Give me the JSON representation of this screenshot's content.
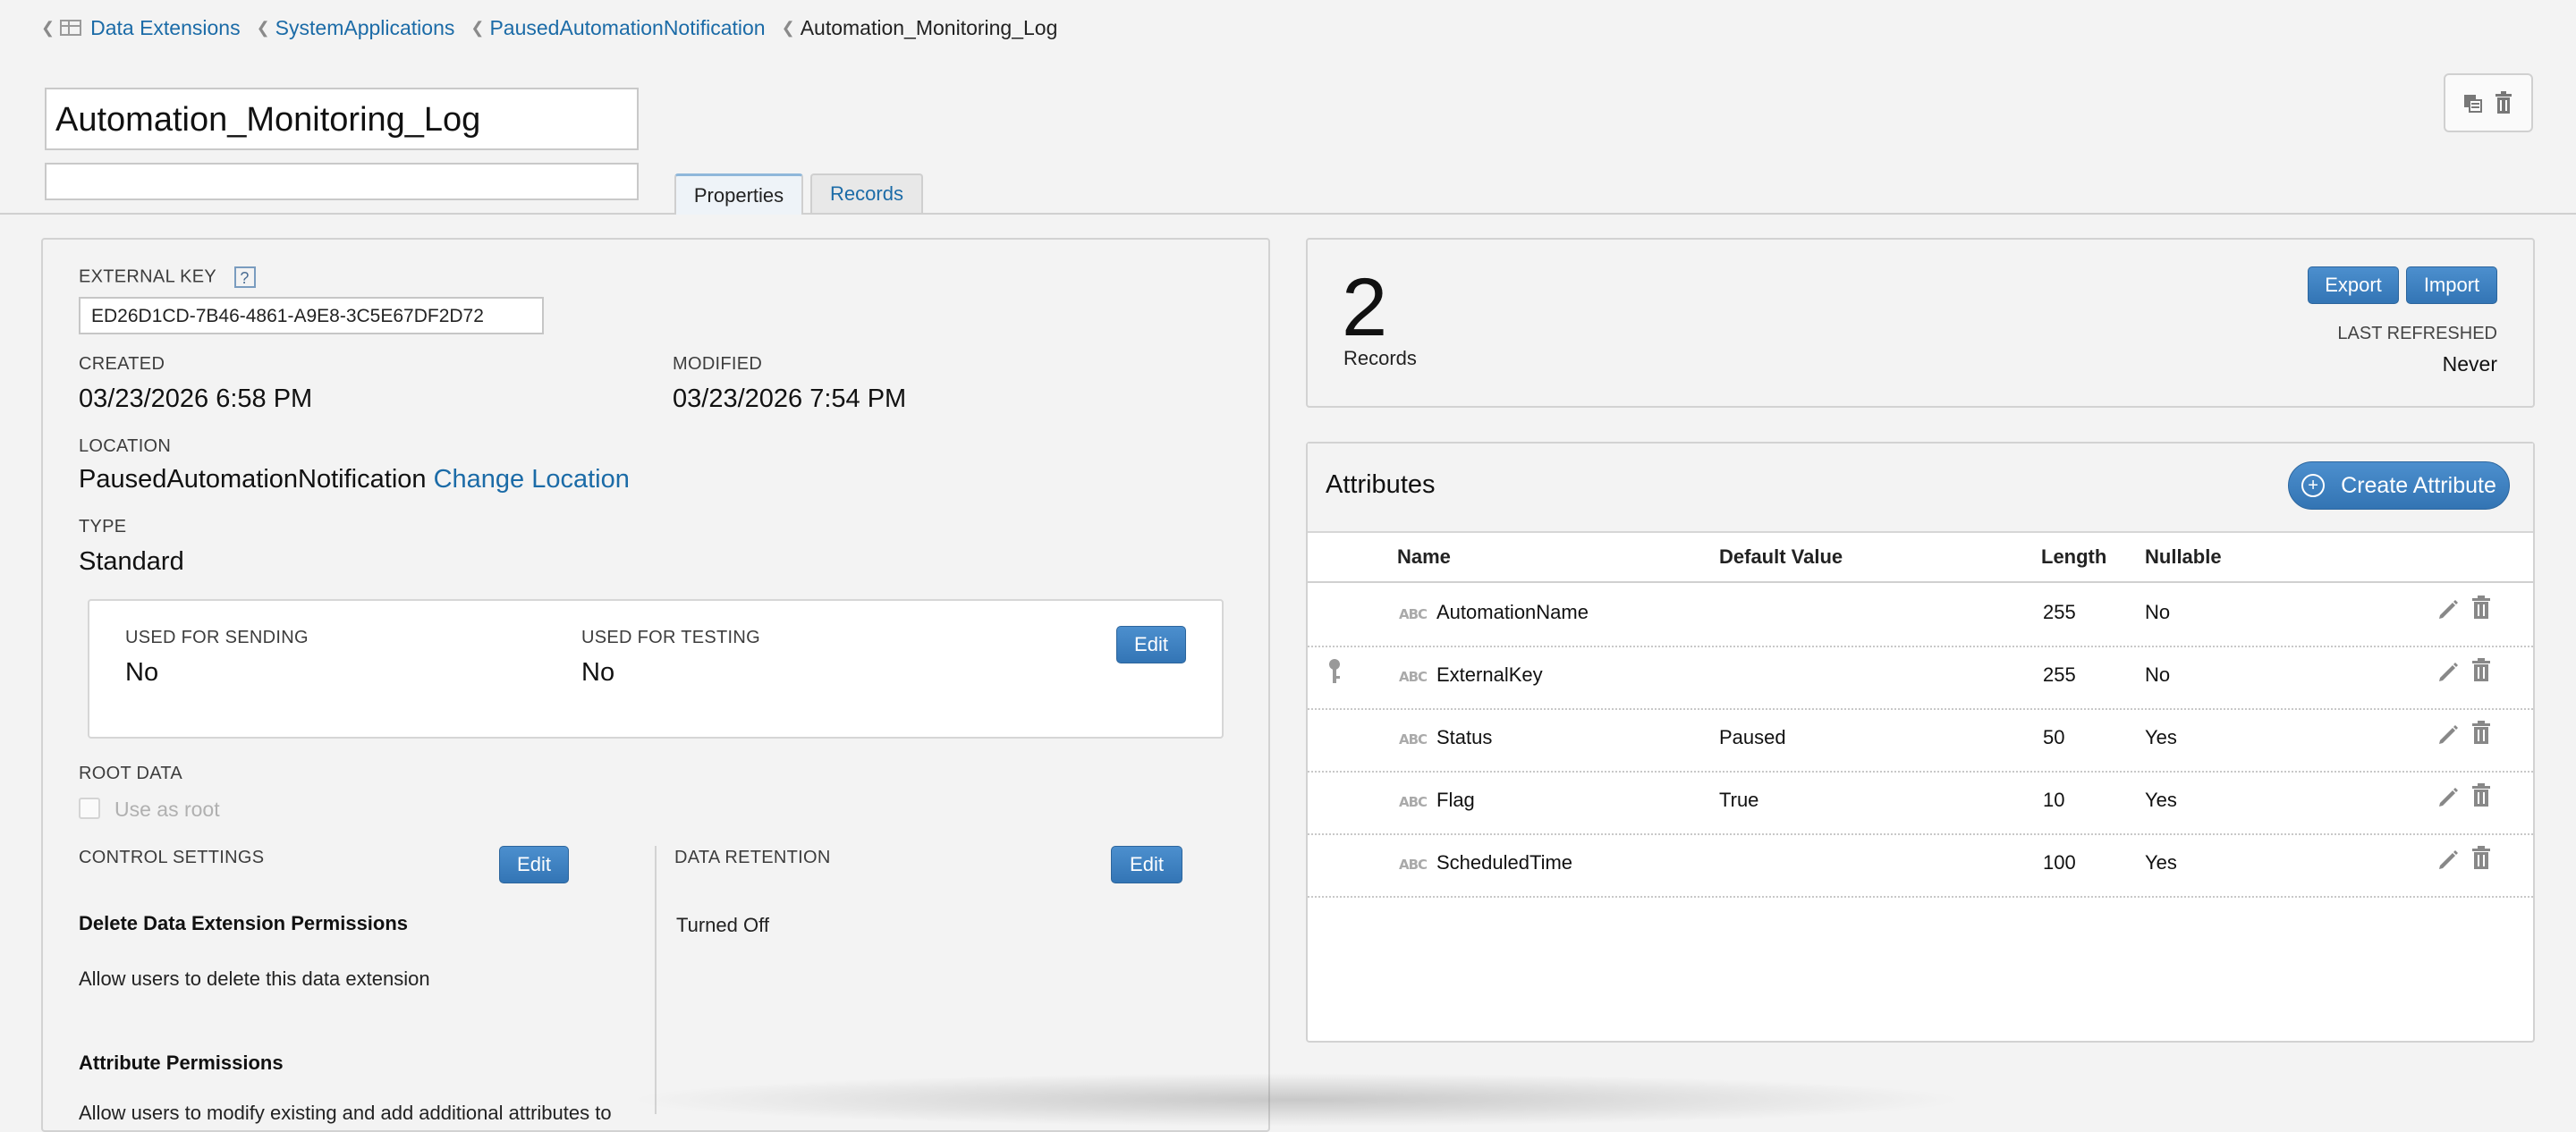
{
  "breadcrumb": {
    "items": [
      "Data Extensions",
      "SystemApplications",
      "PausedAutomationNotification"
    ],
    "current": "Automation_Monitoring_Log"
  },
  "header": {
    "name_value": "Automation_Monitoring_Log",
    "description_value": ""
  },
  "tabs": [
    {
      "label": "Properties",
      "active": true
    },
    {
      "label": "Records",
      "active": false
    }
  ],
  "properties": {
    "external_key_label": "EXTERNAL KEY",
    "external_key_value": "ED26D1CD-7B46-4861-A9E8-3C5E67DF2D72",
    "help_glyph": "?",
    "created_label": "CREATED",
    "created_value": "03/23/2026 6:58 PM",
    "modified_label": "MODIFIED",
    "modified_value": "03/23/2026 7:54 PM",
    "location_label": "LOCATION",
    "location_value": "PausedAutomationNotification",
    "change_location": "Change Location",
    "type_label": "TYPE",
    "type_value": "Standard",
    "used_for_sending_label": "USED FOR SENDING",
    "used_for_sending_value": "No",
    "used_for_testing_label": "USED FOR TESTING",
    "used_for_testing_value": "No",
    "edit_label": "Edit",
    "root_data_label": "ROOT DATA",
    "use_as_root": "Use as root",
    "control_settings_label": "CONTROL SETTINGS",
    "data_retention_label": "DATA RETENTION",
    "delete_permissions_heading": "Delete Data Extension Permissions",
    "delete_permissions_text": "Allow users to delete this data extension",
    "attribute_permissions_heading": "Attribute Permissions",
    "attribute_permissions_text": "Allow users to modify existing and add additional attributes to",
    "retention_value": "Turned Off"
  },
  "records": {
    "count": "2",
    "label": "Records",
    "export": "Export",
    "import": "Import",
    "last_refreshed_label": "LAST REFRESHED",
    "last_refreshed_value": "Never"
  },
  "attributes": {
    "title": "Attributes",
    "create_button": "Create Attribute",
    "columns": [
      "Name",
      "Default Value",
      "Length",
      "Nullable"
    ],
    "type_badge": "ABC",
    "rows": [
      {
        "name": "AutomationName",
        "default": "",
        "length": "255",
        "nullable": "No",
        "primary_key": false
      },
      {
        "name": "ExternalKey",
        "default": "",
        "length": "255",
        "nullable": "No",
        "primary_key": true
      },
      {
        "name": "Status",
        "default": "Paused",
        "length": "50",
        "nullable": "Yes",
        "primary_key": false
      },
      {
        "name": "Flag",
        "default": "True",
        "length": "10",
        "nullable": "Yes",
        "primary_key": false
      },
      {
        "name": "ScheduledTime",
        "default": "",
        "length": "100",
        "nullable": "Yes",
        "primary_key": false
      }
    ]
  },
  "colors": {
    "link": "#1b6ba7",
    "button": "#3a7fc0",
    "background": "#f3f3f3"
  }
}
